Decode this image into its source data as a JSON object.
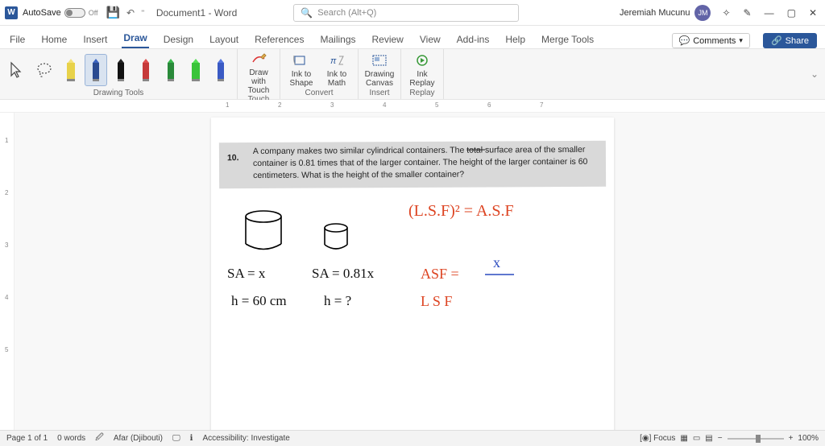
{
  "titlebar": {
    "autosave_label": "AutoSave",
    "autosave_state": "Off",
    "doc_title": "Document1 - Word",
    "search_placeholder": "Search (Alt+Q)",
    "user": {
      "name": "Jeremiah Mucunu",
      "initials": "JM"
    }
  },
  "tabs": {
    "items": [
      "File",
      "Home",
      "Insert",
      "Draw",
      "Design",
      "Layout",
      "References",
      "Mailings",
      "Review",
      "View",
      "Add-ins",
      "Help",
      "Merge Tools"
    ],
    "active": "Draw",
    "comments_label": "Comments",
    "share_label": "Share"
  },
  "ribbon": {
    "groups": {
      "drawing_tools": "Drawing Tools",
      "touch": "Touch",
      "convert": "Convert",
      "insert": "Insert",
      "replay": "Replay"
    },
    "pens": [
      {
        "color": "#e8d24a",
        "tip": "#f4e27a",
        "type": "highlighter"
      },
      {
        "color": "#2a4a90",
        "tip": "#3b63c0",
        "type": "pen",
        "selected": true
      },
      {
        "color": "#111",
        "tip": "#222",
        "type": "pen"
      },
      {
        "color": "#c63a3a",
        "tip": "#e05050",
        "type": "pen"
      },
      {
        "color": "#2a8a3a",
        "tip": "#38b84c",
        "type": "pen"
      },
      {
        "color": "#3ac43a",
        "tip": "#55e055",
        "type": "highlighter"
      },
      {
        "color": "#3a5ac4",
        "tip": "#5577e0",
        "type": "pen"
      }
    ],
    "commands": {
      "draw_touch": "Draw with\nTouch",
      "ink_shape": "Ink to\nShape",
      "ink_math": "Ink to\nMath",
      "canvas": "Drawing\nCanvas",
      "replay": "Ink\nReplay"
    }
  },
  "ruler_marks": [
    "1",
    "2",
    "3",
    "4",
    "5",
    "6",
    "7"
  ],
  "vruler_marks": [
    "1",
    "2",
    "3",
    "4",
    "5"
  ],
  "problem": {
    "number": "10.",
    "line1a": "A company makes two similar cylindrical containers. The ",
    "strike": "total ",
    "line1b": "surface area of the smaller",
    "line2": "container is 0.81 times that of the larger container. The height of the larger container is 60",
    "line3": "centimeters. What is the height of the smaller container?"
  },
  "ink": {
    "formula": "(L.S.F)² = A.S.F",
    "sa_large": "SA = x",
    "sa_small": "SA = 0.81x",
    "h_large": "h = 60 cm",
    "h_small": "h = ?",
    "asf": "ASF  =",
    "asf_x": "x",
    "lsf": "L S F"
  },
  "statusbar": {
    "page": "Page 1 of 1",
    "words": "0 words",
    "lang": "Afar (Djibouti)",
    "access": "Accessibility: Investigate",
    "focus": "Focus",
    "zoom": "100%"
  }
}
